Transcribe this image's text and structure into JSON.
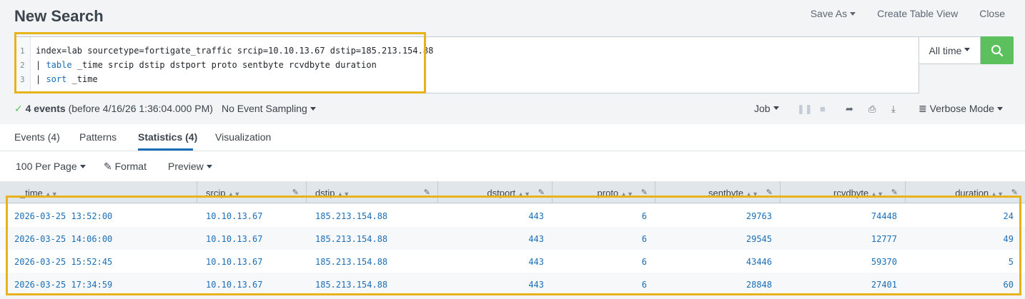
{
  "header": {
    "title": "New Search",
    "actions": [
      "Save As",
      "Create Table View",
      "Close"
    ]
  },
  "search": {
    "line_numbers": [
      "1",
      "2",
      "3"
    ],
    "line1": "index=lab sourcetype=fortigate_traffic srcip=10.10.13.67 dstip=185.213.154.88",
    "line2_pipe": "| ",
    "line2_kw": "table",
    "line2_rest": " _time srcip dstip dstport proto sentbyte rcvdbyte duration",
    "line3_pipe": "| ",
    "line3_kw": "sort",
    "line3_rest": " _time",
    "time_range": "All time"
  },
  "status": {
    "count": "4 events",
    "detail": "(before 4/16/26 1:36:04.000 PM)",
    "sampling": "No Event Sampling",
    "job": "Job",
    "mode": "Verbose Mode"
  },
  "tabs": [
    "Events (4)",
    "Patterns",
    "Statistics (4)",
    "Visualization"
  ],
  "toolbar": {
    "per_page": "100 Per Page",
    "format": "Format",
    "preview": "Preview"
  },
  "table": {
    "columns": [
      "_time",
      "srcip",
      "dstip",
      "dstport",
      "proto",
      "sentbyte",
      "rcvdbyte",
      "duration"
    ],
    "rows": [
      [
        "2026-03-25 13:52:00",
        "10.10.13.67",
        "185.213.154.88",
        "443",
        "6",
        "29763",
        "74448",
        "24"
      ],
      [
        "2026-03-25 14:06:00",
        "10.10.13.67",
        "185.213.154.88",
        "443",
        "6",
        "29545",
        "12777",
        "49"
      ],
      [
        "2026-03-25 15:52:45",
        "10.10.13.67",
        "185.213.154.88",
        "443",
        "6",
        "43446",
        "59370",
        "5"
      ],
      [
        "2026-03-25 17:34:59",
        "10.10.13.67",
        "185.213.154.88",
        "443",
        "6",
        "28848",
        "27401",
        "60"
      ]
    ]
  },
  "colors": {
    "accent": "#1a6eb8",
    "search_button": "#5cc05c",
    "highlight": "#e8b21b"
  }
}
